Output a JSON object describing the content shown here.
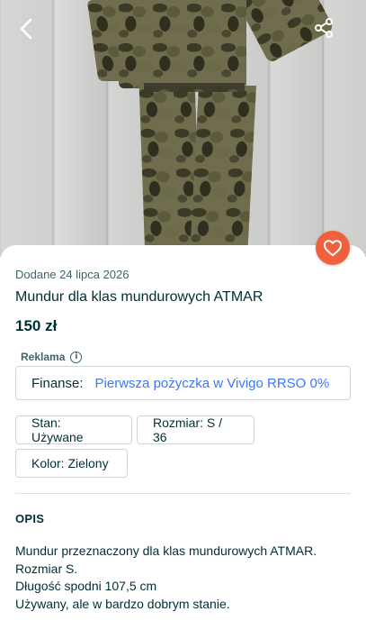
{
  "listing": {
    "added_date": "Dodane 24 lipca 2026",
    "title": "Mundur dla klas mundurowych ATMAR",
    "price": "150 zł"
  },
  "photo": {
    "alt_subject": "camouflage uniform jacket and trousers on floor"
  },
  "nav": {
    "back_icon": "chevron-left-icon",
    "share_icon": "share-icon",
    "favorite_icon": "heart-icon"
  },
  "ad": {
    "label": "Reklama",
    "info_glyph": "i",
    "field_label": "Finanse:",
    "link_text": "Pierwsza pożyczka w Vivigo RRSO 0%"
  },
  "params": [
    {
      "text": "Stan: Używane"
    },
    {
      "text": "Rozmiar: S / 36"
    },
    {
      "text": "Kolor: Zielony"
    }
  ],
  "description": {
    "heading": "OPIS",
    "lines": [
      "Mundur przeznaczony dla klas mundurowych ATMAR.",
      "Rozmiar S.",
      "Długość spodni 107,5 cm",
      "Używany, ale w bardzo dobrym stanie."
    ]
  },
  "colors": {
    "accent": "#f0603f",
    "link": "#3a77ff",
    "text": "#002f34",
    "muted": "#406367",
    "border": "#ced6d7"
  }
}
